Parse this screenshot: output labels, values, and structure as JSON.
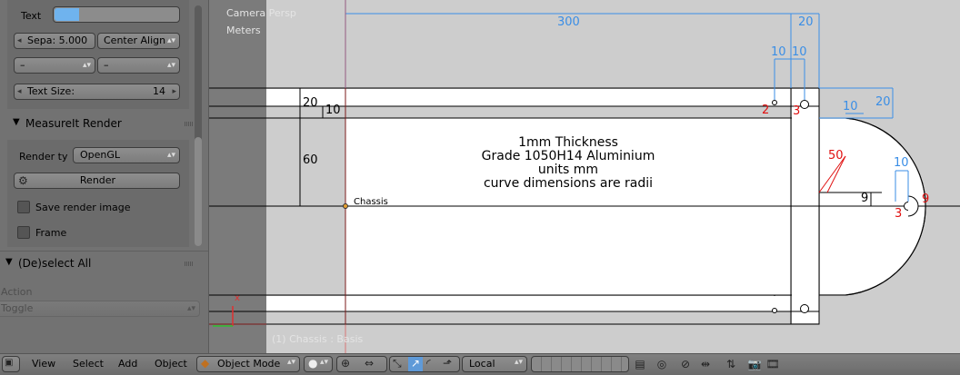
{
  "tool_panel": {
    "text_label": "Text",
    "separation": "Sepa: 5.000",
    "align": "Center Align",
    "left_dropdown": "–",
    "right_dropdown": "–",
    "text_size_label": "Text Size:",
    "text_size_value": "14",
    "render_section_title": "MeasureIt Render",
    "render_type_label": "Render ty",
    "render_type_value": "OpenGL",
    "render_button": "Render",
    "save_render_image": "Save render image",
    "frame": "Frame",
    "deselect_title": "(De)select All",
    "action_label": "Action",
    "action_value": "Toggle"
  },
  "viewport": {
    "camera_label": "Camera Persp",
    "units_label": "Meters",
    "object_status": "(1) Chassis : Basis",
    "object_name": "Chassis",
    "axis_x_label": "x",
    "notes": [
      "1mm Thickness",
      "Grade 1050H14 Aluminium",
      "units mm",
      "curve dimensions are radii"
    ],
    "dims_blue": [
      "300",
      "20",
      "10",
      "10",
      "20",
      "10",
      "10"
    ],
    "dims_black": [
      "20",
      "10",
      "60",
      "9"
    ],
    "dims_red": [
      "2",
      "3",
      "50",
      "3",
      "9"
    ]
  },
  "header": {
    "view": "View",
    "select": "Select",
    "add": "Add",
    "object": "Object",
    "mode": "Object Mode",
    "orientation": "Local"
  },
  "colors": {
    "dim_blue": "#3a8ee6",
    "dim_red": "#e01010",
    "accent_field": "#6fb3ee"
  }
}
